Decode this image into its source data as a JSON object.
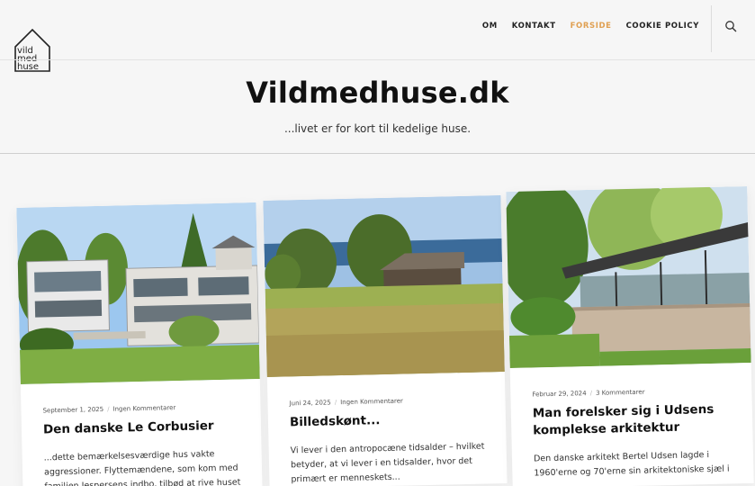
{
  "header": {
    "logo_text": [
      "vild",
      "med",
      "huse"
    ],
    "nav": [
      {
        "label": "OM",
        "active": false
      },
      {
        "label": "KONTAKT",
        "active": false
      },
      {
        "label": "FORSIDE",
        "active": true
      },
      {
        "label": "COOKIE POLICY",
        "active": false
      }
    ],
    "active_color": "#e0a052"
  },
  "site": {
    "title": "Vildmedhuse.dk",
    "tagline": "...livet er for kort til kedelige huse."
  },
  "posts": [
    {
      "date": "September 1, 2025",
      "comments": "Ingen Kommentarer",
      "title": "Den danske Le Corbusier",
      "excerpt": "...dette bemærkelsesværdige hus vakte aggressioner. Flyttemændene, som kom med familien Jespersens indbo, tilbød at rive huset"
    },
    {
      "date": "Juni 24, 2025",
      "comments": "Ingen Kommentarer",
      "title": "Billedskønt...",
      "excerpt": "Vi lever i den antropocæne tidsalder – hvilket betyder, at vi lever i en tidsalder, hvor det primært er menneskets..."
    },
    {
      "date": "Februar 29, 2024",
      "comments": "3 Kommentarer",
      "title": "Man forelsker sig i Udsens komplekse arkitektur",
      "excerpt": "Den danske arkitekt Bertel Udsen lagde i 1960'erne og 70'erne sin arkitektoniske sjæl i"
    }
  ]
}
